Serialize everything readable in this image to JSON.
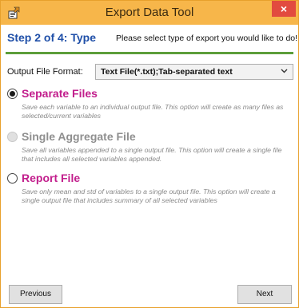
{
  "window": {
    "title": "Export Data Tool",
    "app_icon": "app-settings-icon",
    "close_glyph": "×"
  },
  "step": {
    "header": "Step 2 of 4: Type",
    "instruction": "Please select type of export you would like to do!"
  },
  "output_format": {
    "label": "Output File Format:",
    "selected": "Text File(*.txt);Tab-separated text"
  },
  "options": [
    {
      "label": "Separate Files",
      "description": "Save each variable to an individual output file. This option will create as many files as selected/current variables",
      "checked": true,
      "enabled": true
    },
    {
      "label": "Single Aggregate File",
      "description": "Save all variables appended to a single output file. This option will create a single file that includes all selected variables appended.",
      "checked": false,
      "enabled": false
    },
    {
      "label": "Report File",
      "description": "Save only mean and std of variables to a single output file. This option will create a single output file that includes summary of all selected variables",
      "checked": false,
      "enabled": true
    }
  ],
  "buttons": {
    "previous": "Previous",
    "next": "Next"
  },
  "colors": {
    "titlebar": "#f7b64a",
    "close": "#e24b3f",
    "step_header": "#1f4fa8",
    "rule": "#5c9e3a",
    "option_active": "#c21e8c",
    "option_disabled": "#8f8f8f"
  }
}
